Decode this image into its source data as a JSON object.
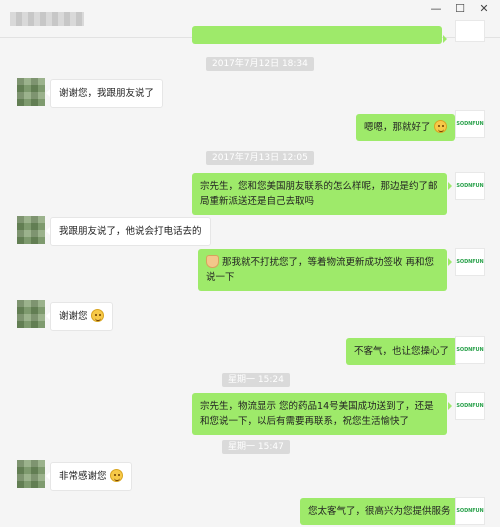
{
  "window": {
    "min": "—",
    "max": "☐",
    "close": "✕"
  },
  "stamps": [
    "2017年7月12日 18:34",
    "2017年7月13日 12:05",
    "星期一 15:24",
    "星期一 15:47"
  ],
  "logo_label": "SODNFUN",
  "messages": [
    {
      "side": "in",
      "text": "谢谢您，我跟朋友说了"
    },
    {
      "side": "out",
      "text": "嗯嗯，那就好了",
      "emoji": "grin-emoji"
    },
    {
      "side": "out",
      "text": "宗先生，您和您美国朋友联系的怎么样呢，那边是约了邮局重新派送还是自己去取吗"
    },
    {
      "side": "in",
      "text": "我跟朋友说了，他说会打电话去的"
    },
    {
      "side": "out",
      "text": "那我就不打扰您了，等着物流更新成功签收 再和您说一下",
      "emoji": "wave-hand-emoji"
    },
    {
      "side": "in",
      "text": "谢谢您",
      "emoji": "smile-emoji"
    },
    {
      "side": "out",
      "text": "不客气，也让您操心了"
    },
    {
      "side": "out",
      "text": "宗先生，物流显示 您的药品14号美国成功送到了，还是和您说一下，以后有需要再联系，祝您生活愉快了"
    },
    {
      "side": "in",
      "text": "非常感谢您",
      "emoji": "smile-emoji"
    },
    {
      "side": "out",
      "text": "您太客气了，很高兴为您提供服务"
    }
  ]
}
